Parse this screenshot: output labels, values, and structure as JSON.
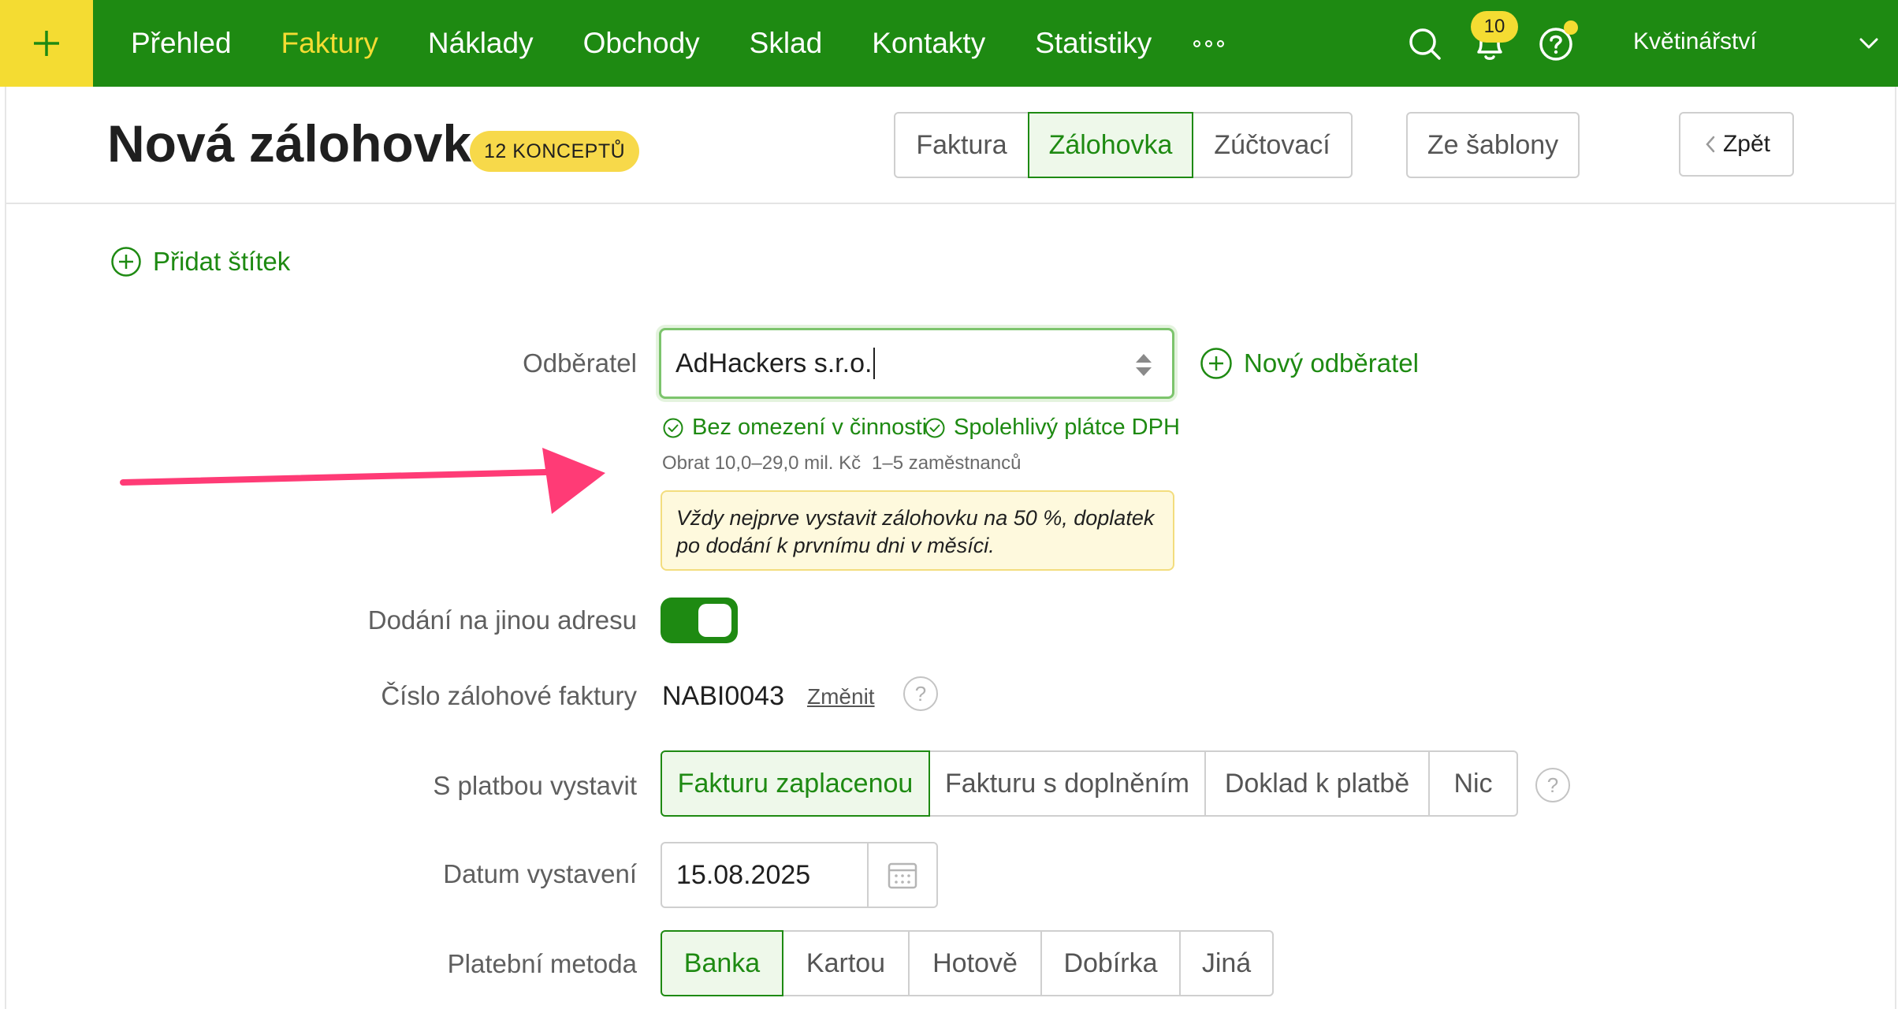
{
  "nav": {
    "add_symbol": "+",
    "items": [
      {
        "label": "Přehled",
        "active": false
      },
      {
        "label": "Faktury",
        "active": true
      },
      {
        "label": "Náklady",
        "active": false
      },
      {
        "label": "Obchody",
        "active": false
      },
      {
        "label": "Sklad",
        "active": false
      },
      {
        "label": "Kontakty",
        "active": false
      },
      {
        "label": "Statistiky",
        "active": false
      }
    ],
    "icons": [
      "search-icon",
      "bell-icon",
      "help-icon"
    ],
    "notification_count": "10",
    "company": "Květinářství"
  },
  "header": {
    "title": "Nová zálohovka",
    "draft_badge": "12 KONCEPTŮ",
    "type_tabs": [
      {
        "label": "Faktura",
        "selected": false
      },
      {
        "label": "Zálohovka",
        "selected": true
      },
      {
        "label": "Zúčtovací",
        "selected": false
      }
    ],
    "from_template": "Ze šablony",
    "back": "Zpět"
  },
  "form": {
    "add_tag": "Přidat štítek",
    "customer": {
      "label": "Odběratel",
      "value": "AdHackers s.r.o.",
      "new_customer": "Nový odběratel",
      "checks": [
        "Bez omezení v činnosti",
        "Spolehlivý plátce DPH"
      ],
      "turnover": "Obrat 10,0–29,0 mil. Kč",
      "employees": "1–5 zaměstnanců",
      "note_line1": "Vždy nejprve vystavit zálohovku na 50 %, doplatek",
      "note_line2": "po dodání k prvnímu dni v měsíci."
    },
    "delivery": {
      "label": "Dodání na jinou adresu",
      "enabled": true
    },
    "invoice_number": {
      "label": "Číslo zálohové faktury",
      "value": "NABI0043",
      "change": "Změnit",
      "help": "?"
    },
    "issue_with_payment": {
      "label": "S platbou vystavit",
      "options": [
        {
          "label": "Fakturu zaplacenou",
          "selected": true
        },
        {
          "label": "Fakturu s doplněním",
          "selected": false
        },
        {
          "label": "Doklad k platbě",
          "selected": false
        },
        {
          "label": "Nic",
          "selected": false
        }
      ],
      "help": "?"
    },
    "issue_date": {
      "label": "Datum vystavení",
      "value": "15.08.2025"
    },
    "payment_method": {
      "label": "Platební metoda",
      "options": [
        {
          "label": "Banka",
          "selected": true
        },
        {
          "label": "Kartou",
          "selected": false
        },
        {
          "label": "Hotově",
          "selected": false
        },
        {
          "label": "Dobírka",
          "selected": false
        },
        {
          "label": "Jiná",
          "selected": false
        }
      ]
    }
  },
  "colors": {
    "brand_green": "#1e8a12",
    "accent_yellow": "#f4dc32",
    "annotation_pink": "#ff3b76"
  }
}
